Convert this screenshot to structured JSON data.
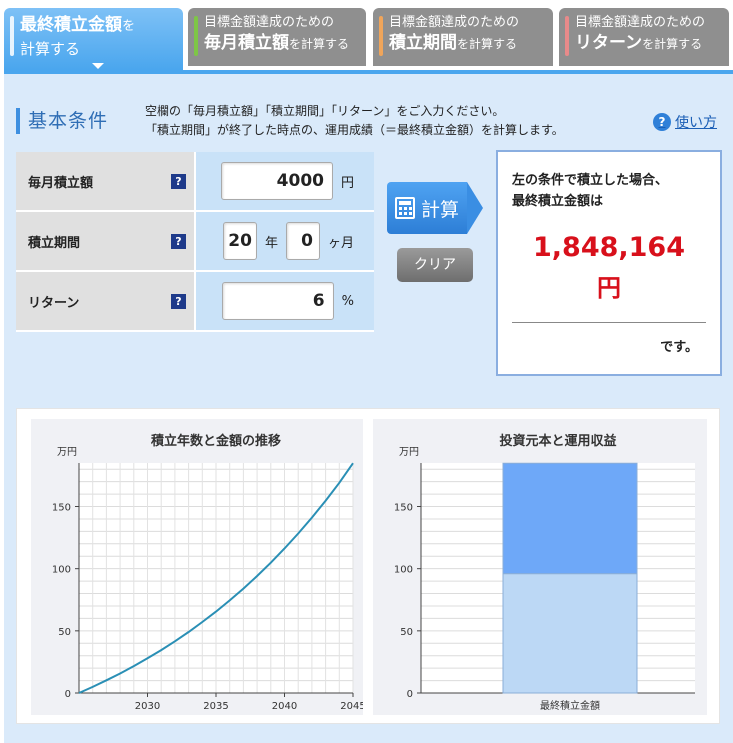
{
  "tabs": [
    {
      "line1": "最終積立金額",
      "line1_suffix": "を",
      "line2": "計算する",
      "active": true,
      "accent": "#4aa6ee"
    },
    {
      "line1": "目標金額達成のための",
      "line2_bold": "毎月積立額",
      "line2_suffix": "を計算する",
      "accent": "#7ec646"
    },
    {
      "line1": "目標金額達成のための",
      "line2_bold": "積立期間",
      "line2_suffix": "を計算する",
      "accent": "#f0a55a"
    },
    {
      "line1": "目標金額達成のための",
      "line2_bold": "リターン",
      "line2_suffix": "を計算する",
      "accent": "#e88a8a"
    }
  ],
  "section_title": "基本条件",
  "intro": {
    "line1": "空欄の「毎月積立額」「積立期間」「リターン」をご入力ください。",
    "line2": "「積立期間」が終了した時点の、運用成績（＝最終積立金額）を計算します。"
  },
  "help": {
    "icon": "?",
    "label": "使い方"
  },
  "form": {
    "monthly": {
      "label": "毎月積立額",
      "value": "4000",
      "unit": "円"
    },
    "period": {
      "label": "積立期間",
      "years": "20",
      "years_unit": "年",
      "months": "0",
      "months_unit": "ヶ月"
    },
    "return": {
      "label": "リターン",
      "value": "6",
      "unit": "%"
    },
    "question_icon": "?"
  },
  "buttons": {
    "calc": "計算",
    "clear": "クリア"
  },
  "result": {
    "line1": "左の条件で積立した場合、",
    "line2": "最終積立金額は",
    "value": "1,848,164",
    "yen": "円",
    "desu": "です。"
  },
  "colors": {
    "accent": "#4aa6ee",
    "result_red": "#d8101b",
    "line": "#2a8fb5",
    "bar_top": "#6ea8f8",
    "bar_bottom": "#bcd8f5"
  },
  "chart_data": [
    {
      "type": "line",
      "title": "積立年数と金額の推移",
      "ylabel": "万円",
      "xlim": [
        2025,
        2045
      ],
      "ylim": [
        0,
        185
      ],
      "xticks": [
        2030,
        2035,
        2040,
        2045
      ],
      "yticks": [
        0,
        50,
        100,
        150
      ],
      "grid": true,
      "x": [
        2025,
        2026,
        2027,
        2028,
        2029,
        2030,
        2031,
        2032,
        2033,
        2034,
        2035,
        2036,
        2037,
        2038,
        2039,
        2040,
        2041,
        2042,
        2043,
        2044,
        2045
      ],
      "values": [
        0,
        4.9,
        10.2,
        15.7,
        21.6,
        27.9,
        34.5,
        41.6,
        49.1,
        57.1,
        65.5,
        74.5,
        84.0,
        94.1,
        104.8,
        116.2,
        128.3,
        141.1,
        154.7,
        169.1,
        184.8
      ]
    },
    {
      "type": "bar",
      "title": "投資元本と運用収益",
      "ylabel": "万円",
      "categories": [
        "最終積立金額"
      ],
      "ylim": [
        0,
        185
      ],
      "yticks": [
        0,
        50,
        100,
        150
      ],
      "grid": true,
      "stacked": true,
      "series": [
        {
          "values": [
            96.0
          ],
          "color": "#bcd8f5"
        },
        {
          "values": [
            88.8
          ],
          "color": "#6ea8f8"
        }
      ]
    }
  ]
}
